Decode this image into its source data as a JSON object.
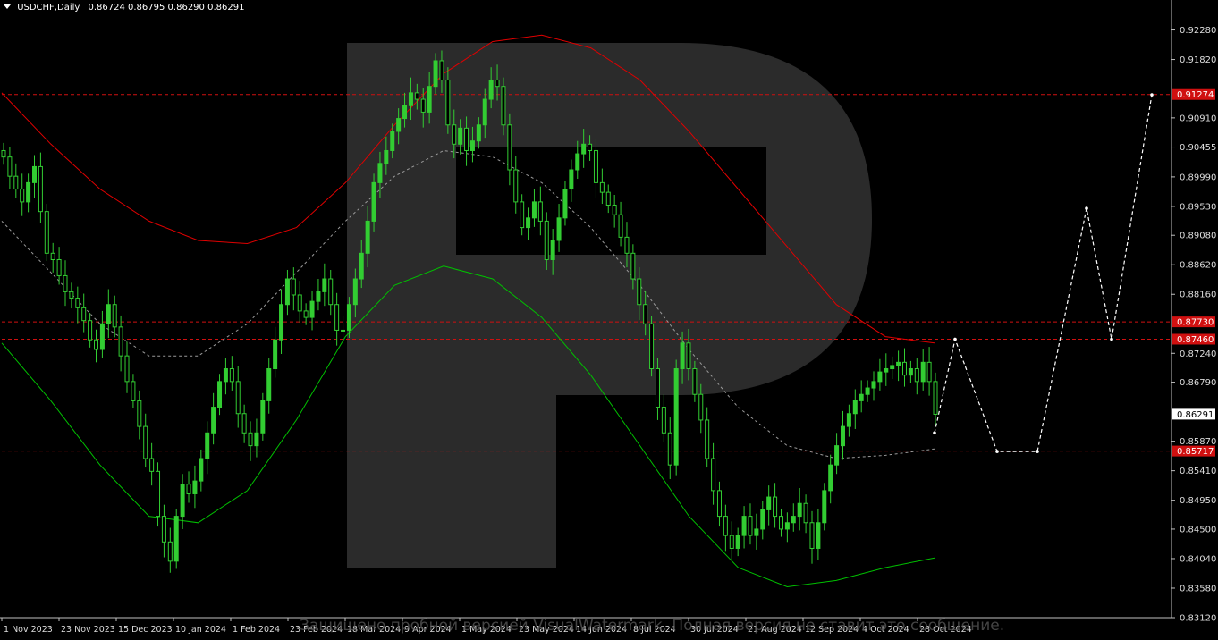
{
  "header": {
    "symbol_line": "USDCHF,Daily",
    "ohlc": "0.86724 0.86795 0.86290 0.86291"
  },
  "watermark_text": "Защищено пробной версией VisualWatermark. Полная версия не ставит это сообщение.",
  "colors": {
    "background": "#000000",
    "axis": "#c0c0c0",
    "candle": "#32cd32",
    "upper_band": "#e00000",
    "lower_band": "#00c000",
    "mid_line": "#9a9a9a",
    "level_line": "#d01010",
    "forecast": "#ffffff",
    "watermark": "#2b2b2b"
  },
  "chart_data": {
    "type": "line",
    "title": "USDCHF,Daily",
    "ylim": [
      0.8312,
      0.9258
    ],
    "y_ticks": [
      "0.92280",
      "0.91820",
      "0.90910",
      "0.90455",
      "0.89990",
      "0.89530",
      "0.89080",
      "0.88620",
      "0.88160",
      "0.87240",
      "0.86790",
      "0.85870",
      "0.85410",
      "0.84950",
      "0.84500",
      "0.84040",
      "0.83580",
      "0.83120"
    ],
    "x_ticks": [
      "1 Nov 2023",
      "23 Nov 2023",
      "15 Dec 2023",
      "10 Jan 2024",
      "1 Feb 2024",
      "23 Feb 2024",
      "18 Mar 2024",
      "9 Apr 2024",
      "1 May 2024",
      "23 May 2024",
      "14 Jun 2024",
      "8 Jul 2024",
      "30 Jul 2024",
      "21 Aug 2024",
      "12 Sep 2024",
      "4 Oct 2024",
      "28 Oct 2024"
    ],
    "current_price": "0.86291",
    "levels": [
      {
        "label": "0.91274",
        "value": 0.91274
      },
      {
        "label": "0.87730",
        "value": 0.8773
      },
      {
        "label": "0.87460",
        "value": 0.8746
      },
      {
        "label": "0.85717",
        "value": 0.85717
      }
    ],
    "grid": false,
    "legend": "none",
    "series": [
      {
        "kind": "price",
        "values": [
          0.903,
          0.9,
          0.898,
          0.896,
          0.899,
          0.9015,
          0.8945,
          0.888,
          0.887,
          0.8845,
          0.882,
          0.881,
          0.8795,
          0.8775,
          0.8745,
          0.873,
          0.877,
          0.88,
          0.8765,
          0.872,
          0.868,
          0.865,
          0.861,
          0.856,
          0.854,
          0.847,
          0.843,
          0.84,
          0.847,
          0.852,
          0.8505,
          0.8525,
          0.856,
          0.86,
          0.864,
          0.868,
          0.87,
          0.868,
          0.863,
          0.86,
          0.858,
          0.86,
          0.865,
          0.87,
          0.8745,
          0.88,
          0.884,
          0.8815,
          0.879,
          0.878,
          0.8805,
          0.882,
          0.884,
          0.88,
          0.876,
          0.876,
          0.88,
          0.884,
          0.888,
          0.893,
          0.899,
          0.902,
          0.904,
          0.907,
          0.909,
          0.911,
          0.913,
          0.912,
          0.91,
          0.914,
          0.918,
          0.915,
          0.908,
          0.905,
          0.9075,
          0.904,
          0.9055,
          0.908,
          0.912,
          0.915,
          0.914,
          0.908,
          0.901,
          0.896,
          0.892,
          0.8935,
          0.896,
          0.893,
          0.887,
          0.89,
          0.8935,
          0.898,
          0.901,
          0.9035,
          0.905,
          0.904,
          0.899,
          0.8975,
          0.8955,
          0.894,
          0.8905,
          0.888,
          0.884,
          0.88,
          0.877,
          0.87,
          0.864,
          0.86,
          0.855,
          0.87,
          0.874,
          0.87,
          0.866,
          0.862,
          0.856,
          0.851,
          0.847,
          0.844,
          0.842,
          0.844,
          0.847,
          0.844,
          0.845,
          0.848,
          0.85,
          0.847,
          0.845,
          0.846,
          0.847,
          0.849,
          0.846,
          0.842,
          0.846,
          0.851,
          0.855,
          0.858,
          0.861,
          0.863,
          0.865,
          0.866,
          0.867,
          0.868,
          0.8695,
          0.87,
          0.8705,
          0.871,
          0.869,
          0.87,
          0.868,
          0.871,
          0.868,
          0.8629
        ]
      },
      {
        "kind": "upper_band",
        "values": [
          0.913,
          0.905,
          0.898,
          0.893,
          0.89,
          0.8895,
          0.892,
          0.899,
          0.908,
          0.916,
          0.921,
          0.922,
          0.92,
          0.915,
          0.907,
          0.898,
          0.889,
          0.88,
          0.875,
          0.874
        ]
      },
      {
        "kind": "mid_line",
        "values": [
          0.893,
          0.885,
          0.877,
          0.872,
          0.872,
          0.877,
          0.885,
          0.893,
          0.9,
          0.904,
          0.903,
          0.899,
          0.892,
          0.883,
          0.873,
          0.864,
          0.858,
          0.856,
          0.8565,
          0.8575
        ]
      },
      {
        "kind": "lower_band",
        "values": [
          0.874,
          0.865,
          0.855,
          0.847,
          0.846,
          0.851,
          0.862,
          0.875,
          0.883,
          0.886,
          0.884,
          0.878,
          0.869,
          0.858,
          0.847,
          0.839,
          0.836,
          0.837,
          0.839,
          0.8405
        ]
      },
      {
        "kind": "forecast",
        "values": [
          0.86,
          0.8746,
          0.8571,
          0.8571,
          0.895,
          0.8746,
          0.9127
        ]
      }
    ]
  }
}
